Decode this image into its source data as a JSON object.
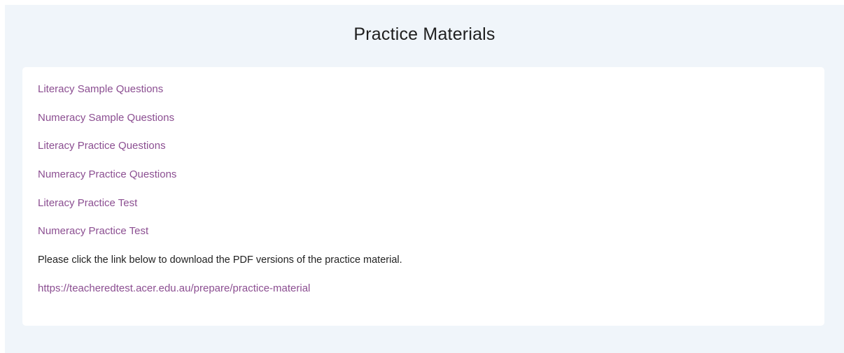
{
  "title": "Practice Materials",
  "links": [
    "Literacy Sample Questions",
    "Numeracy Sample Questions",
    "Literacy Practice Questions",
    "Numeracy Practice Questions",
    "Literacy Practice Test",
    "Numeracy Practice Test"
  ],
  "note": "Please click the link below to download the PDF versions of the practice material.",
  "pdf_link": "https://teacheredtest.acer.edu.au/prepare/practice-material",
  "colors": {
    "background_panel": "#f0f5fa",
    "card": "#ffffff",
    "link": "#8b4e91",
    "text": "#222222"
  }
}
